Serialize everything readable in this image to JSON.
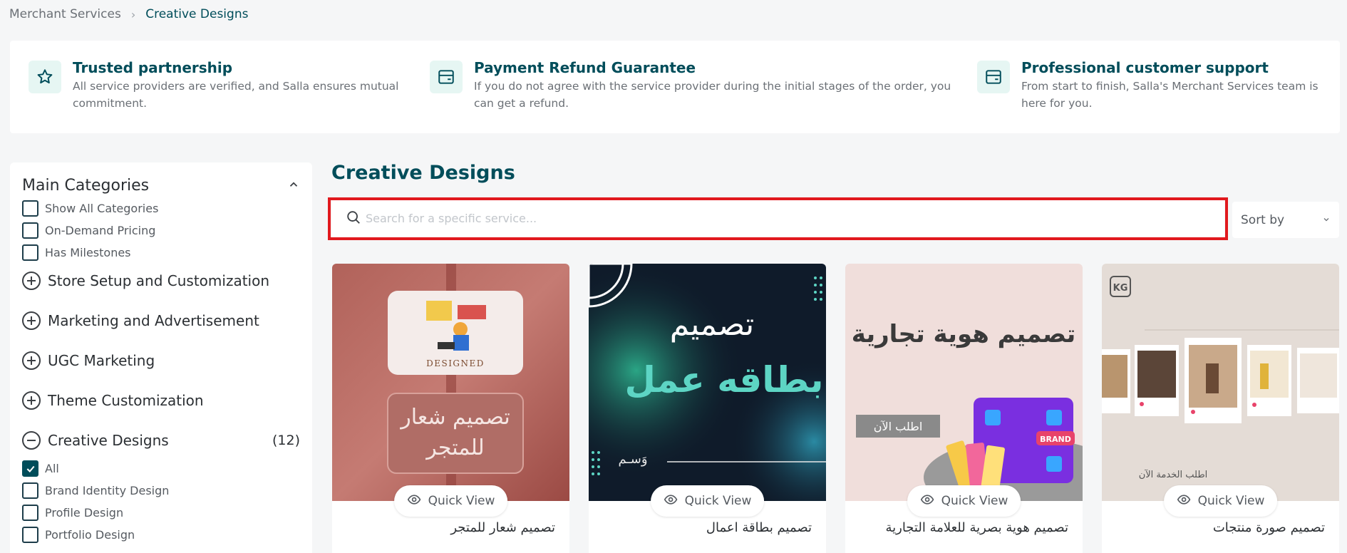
{
  "breadcrumb": {
    "items": [
      "Merchant Services",
      "Creative Designs"
    ]
  },
  "features": [
    {
      "icon": "star-icon",
      "title": "Trusted partnership",
      "desc_1": "All service providers are verified, and Salla ensures mutual",
      "desc_2": "commitment."
    },
    {
      "icon": "card-icon",
      "title": "Payment Refund Guarantee",
      "desc_1": "If you do not agree with the service provider during the initial stages of the order, you",
      "desc_2": "can get a refund."
    },
    {
      "icon": "card-icon",
      "title": "Professional customer support",
      "desc_1": "From start to finish, Salla's Merchant Services team is",
      "desc_2": "here for you."
    }
  ],
  "sidebar": {
    "title": "Main Categories",
    "filters": [
      "Show All Categories",
      "On-Demand Pricing",
      "Has Milestones"
    ],
    "categories": [
      "Store Setup and Customization",
      "Marketing and Advertisement",
      "UGC Marketing",
      "Theme Customization"
    ],
    "expanded": {
      "label": "Creative Designs",
      "count": "(12)"
    },
    "subcategories": [
      {
        "label": "All",
        "checked": true
      },
      {
        "label": "Brand Identity Design",
        "checked": false
      },
      {
        "label": "Profile Design",
        "checked": false
      },
      {
        "label": "Portfolio Design",
        "checked": false
      }
    ]
  },
  "main": {
    "title": "Creative Designs",
    "search_placeholder": "Search for a specific service...",
    "sort_label": "Sort by"
  },
  "quick_view_label": "Quick View",
  "cards": [
    {
      "name": "تصميم شعار للمتجر",
      "img_designed": "DESIGNED",
      "img_line1": "تصميم شعار",
      "img_line2": "للمتجر"
    },
    {
      "name": "تصميم بطاقة اعمال",
      "img_line1": "تصميم",
      "img_line2": "بطاقه عمل",
      "img_sign": "وَسـم"
    },
    {
      "name": "تصميم هوية بصرية للعلامة التجارية",
      "img_line1": "تصميم هوية تجارية",
      "img_button": "اطلب الآن",
      "img_badge": "BRAND"
    },
    {
      "name": "تصميم صورة منتجات",
      "img_logo": "KG",
      "img_footer": "اطلب الخدمة الآن"
    }
  ],
  "colors": {
    "primary": "#004d5a",
    "accent": "#5dd5c4",
    "highlight": "#e1191e"
  }
}
